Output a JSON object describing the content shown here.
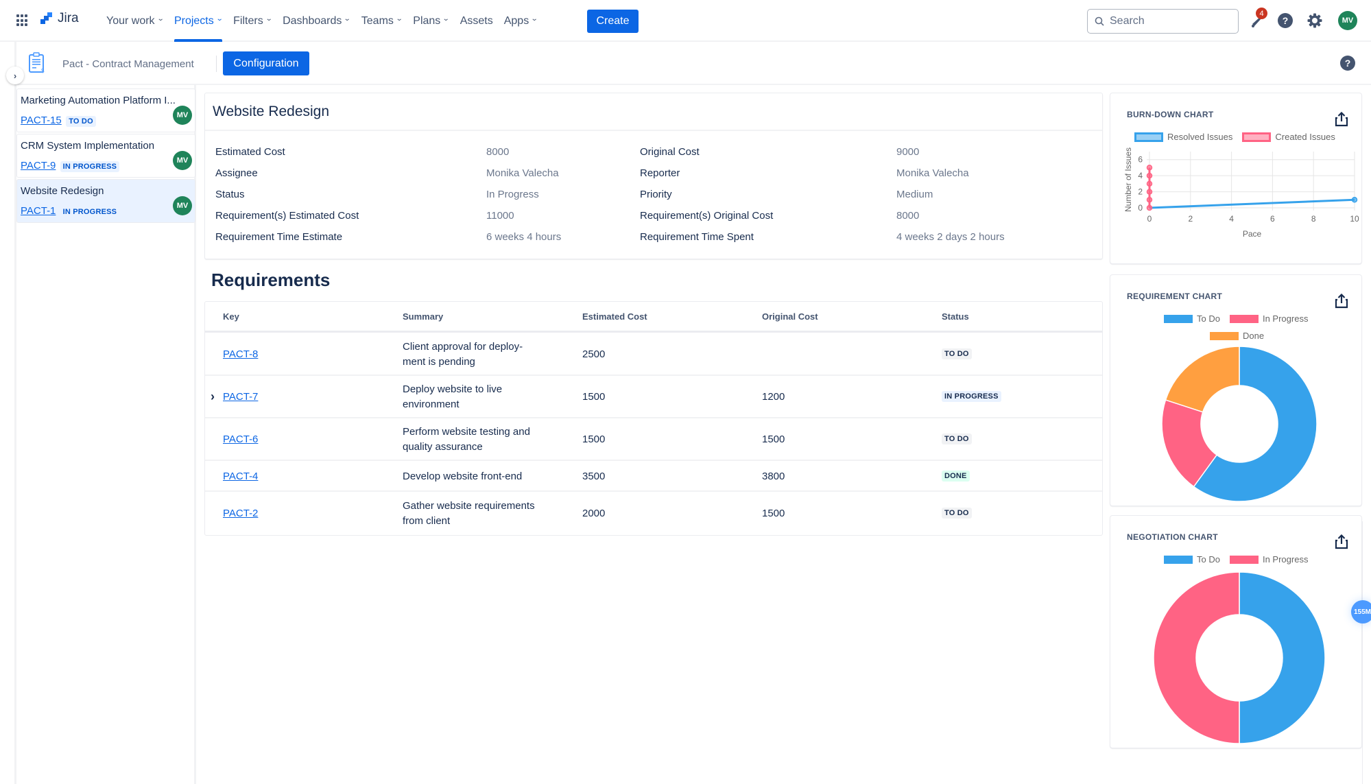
{
  "topnav": {
    "app_name": "Jira",
    "items": [
      {
        "label": "Your work",
        "dropdown": true,
        "active": false
      },
      {
        "label": "Projects",
        "dropdown": true,
        "active": true
      },
      {
        "label": "Filters",
        "dropdown": true,
        "active": false
      },
      {
        "label": "Dashboards",
        "dropdown": true,
        "active": false
      },
      {
        "label": "Teams",
        "dropdown": true,
        "active": false
      },
      {
        "label": "Plans",
        "dropdown": true,
        "active": false
      },
      {
        "label": "Assets",
        "dropdown": false,
        "active": false
      },
      {
        "label": "Apps",
        "dropdown": true,
        "active": false
      }
    ],
    "create_label": "Create",
    "search_placeholder": "Search",
    "notification_count": "4",
    "user_initials": "MV",
    "icons": {
      "app_switcher": "grid-icon",
      "notifications": "bell-icon",
      "help": "help-icon",
      "settings": "gear-icon"
    }
  },
  "subheader": {
    "project_name": "Pact - Contract Management",
    "configuration_label": "Configuration",
    "toggle_glyph": "›"
  },
  "sidebar": {
    "projects": [
      {
        "title": "Marketing Automation Platform I...",
        "key": "PACT-15",
        "status": "TO DO",
        "assignee_initials": "MV",
        "selected": false
      },
      {
        "title": "CRM System Implementation",
        "key": "PACT-9",
        "status": "IN PROGRESS",
        "assignee_initials": "MV",
        "selected": false
      },
      {
        "title": "Website Redesign",
        "key": "PACT-1",
        "status": "IN PROGRESS",
        "assignee_initials": "MV",
        "selected": true
      }
    ]
  },
  "detail": {
    "title": "Website Redesign",
    "left_fields": [
      {
        "label": "Estimated Cost",
        "value": "8000"
      },
      {
        "label": "Assignee",
        "value": "Monika Valecha"
      },
      {
        "label": "Status",
        "value": "In Progress"
      },
      {
        "label": "Requirement(s) Estimated Cost",
        "value": "11000"
      },
      {
        "label": "Requirement Time Estimate",
        "value": "6 weeks 4 hours"
      }
    ],
    "right_fields": [
      {
        "label": "Original Cost",
        "value": "9000"
      },
      {
        "label": "Reporter",
        "value": "Monika Valecha"
      },
      {
        "label": "Priority",
        "value": "Medium"
      },
      {
        "label": "Requirement(s) Original Cost",
        "value": "8000"
      },
      {
        "label": "Requirement Time Spent",
        "value": "4 weeks 2 days 2 hours"
      }
    ]
  },
  "requirements": {
    "heading": "Requirements",
    "columns": [
      "Key",
      "Summary",
      "Estimated Cost",
      "Original Cost",
      "Status"
    ],
    "rows": [
      {
        "key": "PACT-8",
        "summary": "Client approval for deploy-ment is pending",
        "summary_lines": [
          "Client approval for deploy-",
          "ment is pending"
        ],
        "estimated_cost": "2500",
        "original_cost": "",
        "status": "TO DO",
        "expandable": false
      },
      {
        "key": "PACT-7",
        "summary": "Deploy website to live environment",
        "summary_lines": [
          "Deploy website to live",
          "environment"
        ],
        "estimated_cost": "1500",
        "original_cost": "1200",
        "status": "IN PROGRESS",
        "expandable": true
      },
      {
        "key": "PACT-6",
        "summary": "Perform website testing and quality assurance",
        "summary_lines": [
          "Perform website testing and",
          "quality assurance"
        ],
        "estimated_cost": "1500",
        "original_cost": "1500",
        "status": "TO DO",
        "expandable": false
      },
      {
        "key": "PACT-4",
        "summary": "Develop website front-end",
        "summary_lines": [
          "Develop website front-end"
        ],
        "estimated_cost": "3500",
        "original_cost": "3800",
        "status": "DONE",
        "expandable": false
      },
      {
        "key": "PACT-2",
        "summary": "Gather website requirements from client",
        "summary_lines": [
          "Gather website requirements",
          "from client"
        ],
        "estimated_cost": "2000",
        "original_cost": "1500",
        "status": "TO DO",
        "expandable": false
      }
    ]
  },
  "colors": {
    "brand_blue": "#0c66e4",
    "chart_blue": "#36a2eb",
    "chart_pink": "#ff6384",
    "chart_orange": "#ff9f40",
    "avatar_green": "#1f845a"
  },
  "floating_badge": "155M",
  "chart_data": [
    {
      "type": "line",
      "title": "BURN-DOWN CHART",
      "xlabel": "Pace",
      "ylabel": "Number of Issues",
      "xlim": [
        0,
        10
      ],
      "ylim": [
        0,
        7
      ],
      "x_ticks": [
        "0",
        "2",
        "4",
        "6",
        "8",
        "10"
      ],
      "y_ticks": [
        "0",
        "2",
        "4",
        "6"
      ],
      "grid": true,
      "legend_position": "top",
      "series": [
        {
          "name": "Resolved Issues",
          "color": "#36a2eb",
          "points": [
            [
              0,
              0
            ],
            [
              10,
              1
            ]
          ]
        },
        {
          "name": "Created Issues",
          "color": "#ff6384",
          "points": [
            [
              0,
              0
            ],
            [
              0,
              1
            ],
            [
              0,
              2
            ],
            [
              0,
              3
            ],
            [
              0,
              4
            ],
            [
              0,
              5
            ]
          ]
        }
      ]
    },
    {
      "type": "pie",
      "title": "REQUIREMENT CHART",
      "donut": true,
      "legend_position": "top",
      "categories": [
        "To Do",
        "In Progress",
        "Done"
      ],
      "values": [
        3,
        1,
        1
      ],
      "colors": [
        "#36a2eb",
        "#ff6384",
        "#ff9f40"
      ]
    },
    {
      "type": "pie",
      "title": "NEGOTIATION CHART",
      "donut": true,
      "legend_position": "top",
      "categories": [
        "To Do",
        "In Progress"
      ],
      "values": [
        1,
        1
      ],
      "colors": [
        "#36a2eb",
        "#ff6384"
      ]
    }
  ]
}
